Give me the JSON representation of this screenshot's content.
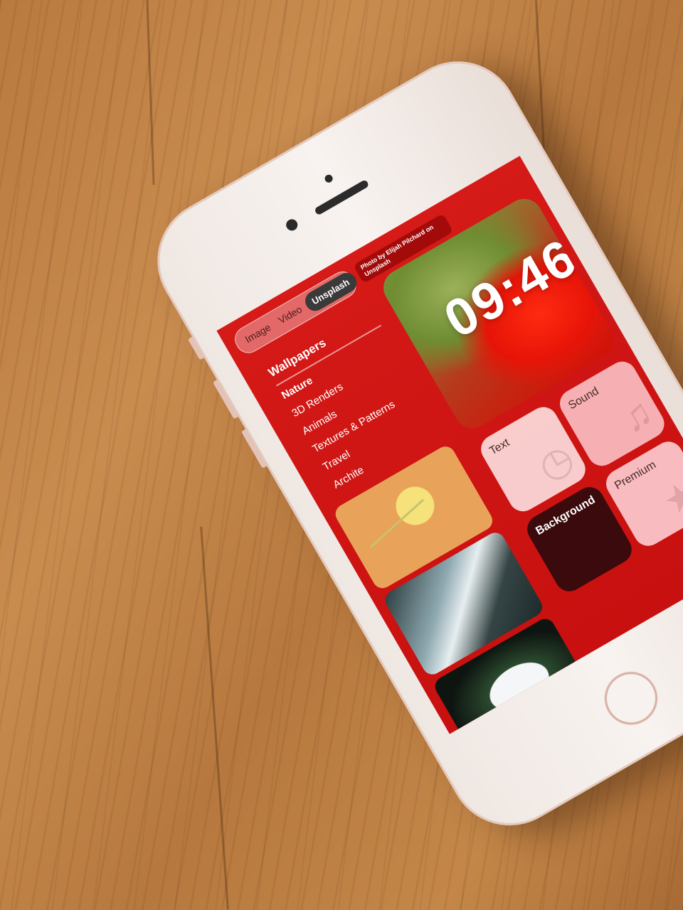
{
  "screen": {
    "tabs": [
      {
        "label": "Image",
        "active": false
      },
      {
        "label": "Video",
        "active": false
      },
      {
        "label": "Unsplash",
        "active": true
      }
    ],
    "photo_credit": "Photo by Elijah Pilchard on Unsplash",
    "clock": "09:46",
    "section_title": "Wallpapers",
    "categories": [
      {
        "label": "Nature",
        "selected": true
      },
      {
        "label": "3D Renders",
        "selected": false
      },
      {
        "label": "Animals",
        "selected": false
      },
      {
        "label": "Textures & Patterns",
        "selected": false
      },
      {
        "label": "Travel",
        "selected": false
      },
      {
        "label": "Archite",
        "selected": false
      }
    ],
    "cards": {
      "text": "Text",
      "sound": "Sound",
      "background": "Background",
      "premium": "Premium"
    },
    "icons": {
      "text": "clock-icon",
      "sound": "music-note-icon",
      "premium": "star-icon"
    }
  },
  "colors": {
    "screen_red": "#d51a17",
    "background_card": "#3b0a0c",
    "phone_body": "#f4ede9"
  }
}
